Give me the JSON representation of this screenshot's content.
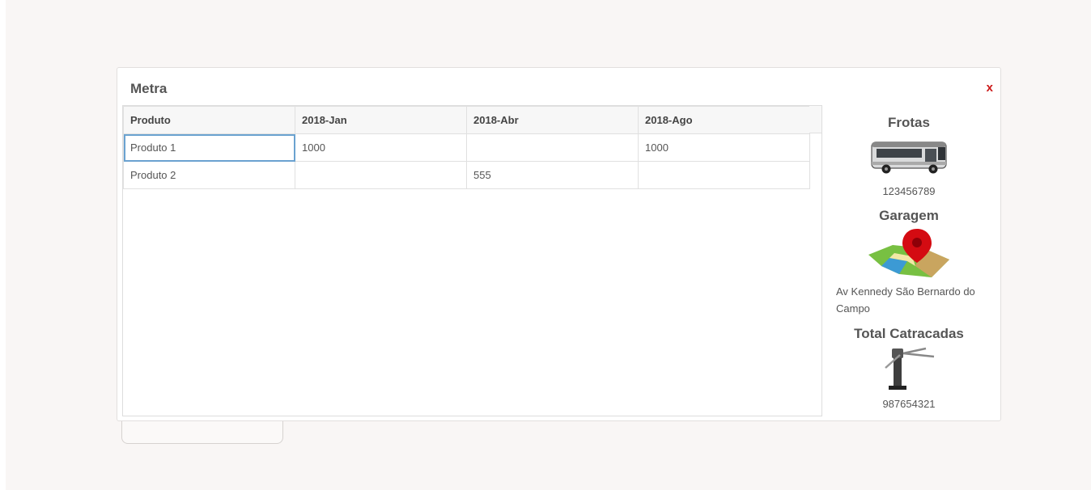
{
  "modal": {
    "title": "Metra",
    "close_label": "x"
  },
  "table": {
    "headers": [
      "Produto",
      "2018-Jan",
      "2018-Abr",
      "2018-Ago"
    ],
    "rows": [
      [
        "Produto 1",
        "1000",
        "",
        "1000"
      ],
      [
        "Produto 2",
        "",
        "555",
        ""
      ]
    ]
  },
  "side": {
    "fleet": {
      "heading": "Frotas",
      "value": "123456789",
      "icon": "bus-icon"
    },
    "garage": {
      "heading": "Garagem",
      "address": "Av Kennedy São Bernardo do Campo",
      "icon": "map-pin-icon"
    },
    "turnstiles": {
      "heading": "Total Catracadas",
      "value": "987654321",
      "icon": "turnstile-icon"
    }
  },
  "colors": {
    "close": "#cc1a1a",
    "selected_cell_border": "#6aa2d0",
    "page_background": "#f9f6f5"
  }
}
